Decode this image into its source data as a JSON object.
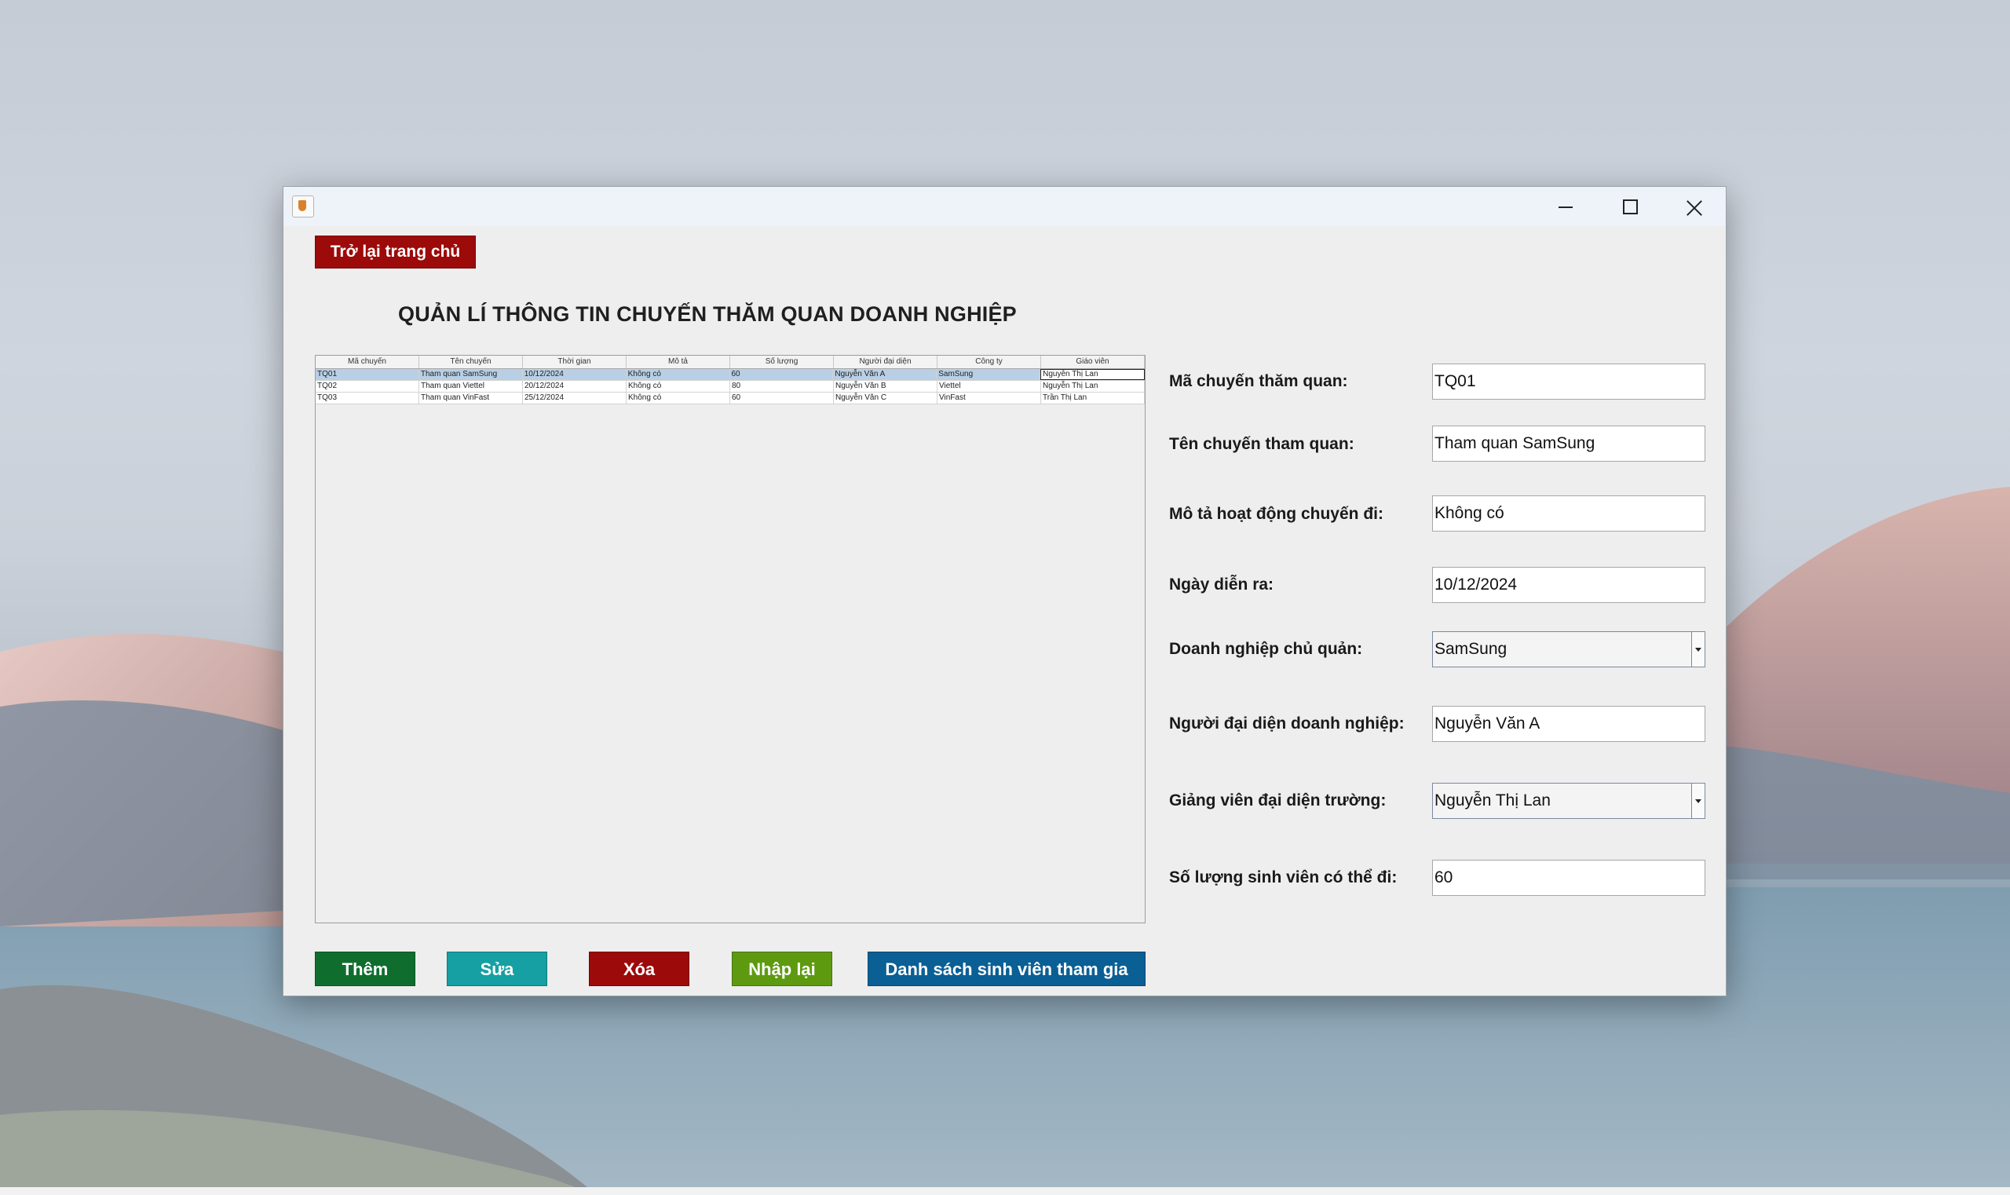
{
  "window": {
    "back_button": "Trở lại trang chủ",
    "title": "QUẢN LÍ THÔNG TIN CHUYẾN THĂM QUAN DOANH NGHIỆP"
  },
  "table": {
    "columns": [
      "Mã chuyến",
      "Tên chuyến",
      "Thời gian",
      "Mô tả",
      "Số lượng",
      "Người đại diện",
      "Công ty",
      "Giáo viên"
    ],
    "rows": [
      [
        "TQ01",
        "Tham quan SamSung",
        "10/12/2024",
        "Không có",
        "60",
        "Nguyễn Văn A",
        "SamSung",
        "Nguyễn Thị Lan"
      ],
      [
        "TQ02",
        "Tham quan Viettel",
        "20/12/2024",
        "Không có",
        "80",
        "Nguyễn Văn B",
        "Viettel",
        "Nguyễn Thị Lan"
      ],
      [
        "TQ03",
        "Tham quan VinFast",
        "25/12/2024",
        "Không có",
        "60",
        "Nguyễn Văn C",
        "VinFast",
        "Trần Thị Lan"
      ]
    ]
  },
  "form": {
    "ma_label": "Mã chuyến thăm quan:",
    "ma_value": "TQ01",
    "ten_label": "Tên chuyến tham quan:",
    "ten_value": "Tham quan SamSung",
    "mota_label": "Mô tả hoạt động chuyến đi:",
    "mota_value": "Không có",
    "ngay_label": "Ngày diễn ra:",
    "ngay_value": "10/12/2024",
    "dn_label": "Doanh nghiệp chủ quản:",
    "dn_value": "SamSung",
    "ndd_label": "Người đại diện doanh nghiệp:",
    "ndd_value": "Nguyễn Văn A",
    "gv_label": "Giảng viên đại diện trường:",
    "gv_value": "Nguyễn Thị Lan",
    "sl_label": "Số lượng sinh viên có thể đi:",
    "sl_value": "60"
  },
  "buttons": {
    "add": "Thêm",
    "edit": "Sửa",
    "delete": "Xóa",
    "reset": "Nhập lại",
    "list": "Danh sách sinh viên tham gia"
  }
}
